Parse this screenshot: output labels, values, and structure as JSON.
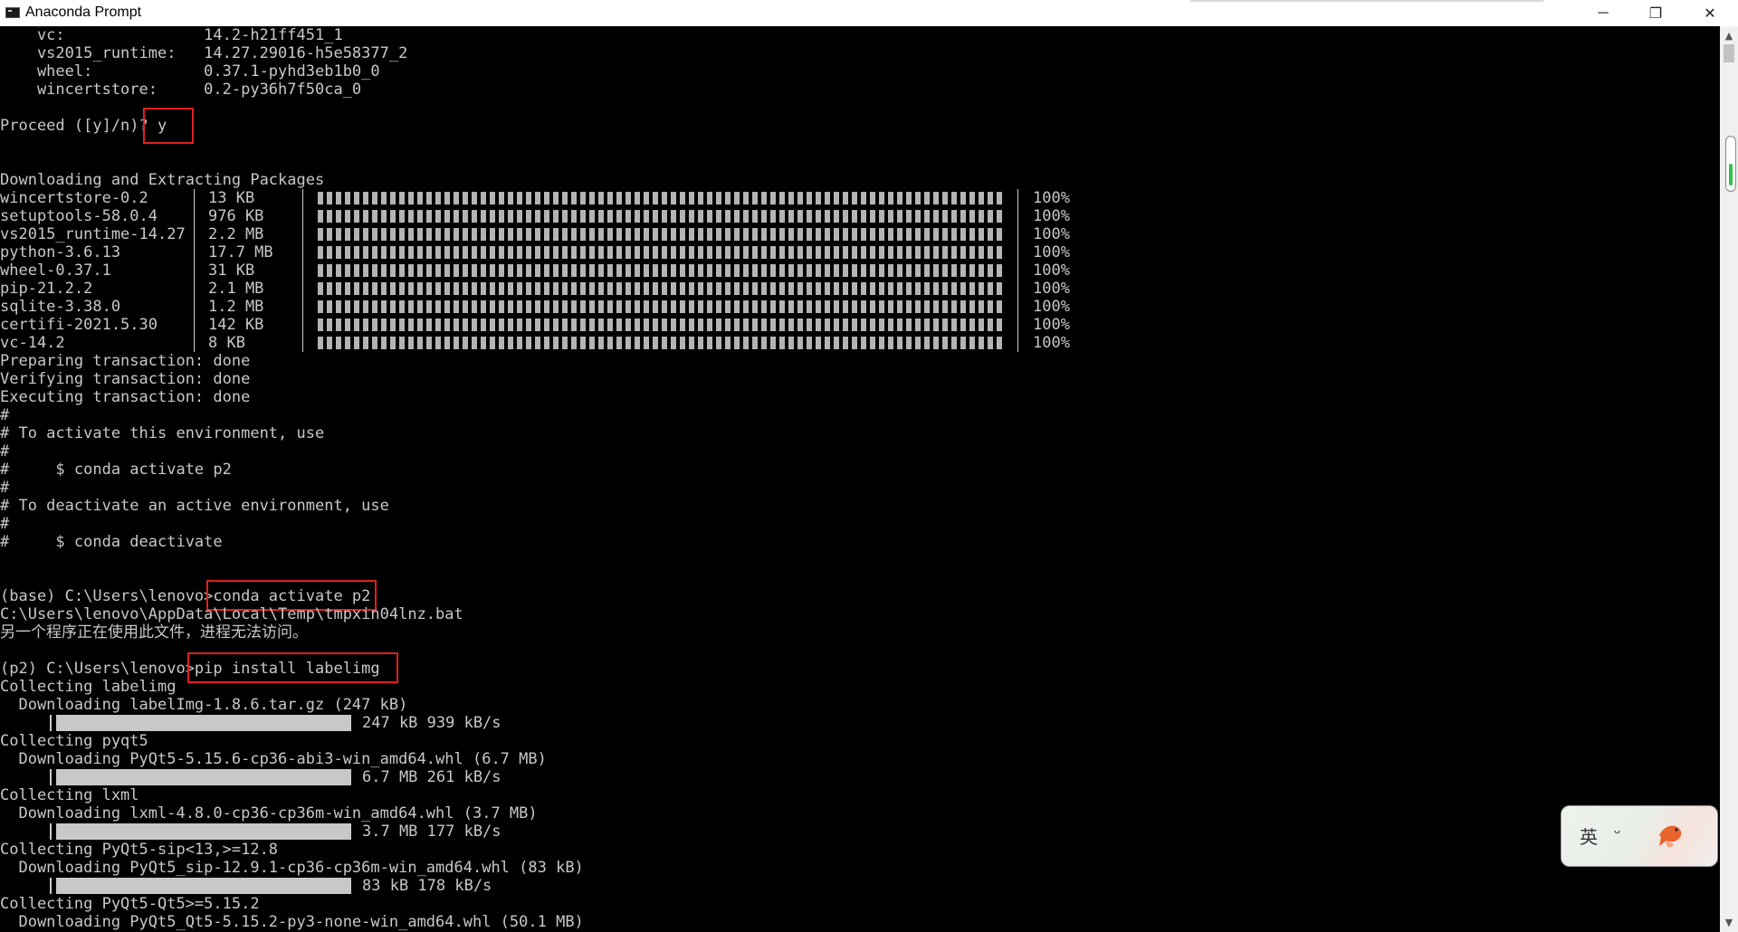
{
  "window": {
    "title": "Anaconda Prompt",
    "minimize": "─",
    "maximize": "❐",
    "close": "✕"
  },
  "pre_lines": [
    "    vc:               14.2-h21ff451_1",
    "    vs2015_runtime:   14.27.29016-h5e58377_2",
    "    wheel:            0.37.1-pyhd3eb1b0_0",
    "    wincertstore:     0.2-py36h7f50ca_0"
  ],
  "proceed": "Proceed ([y]/n)? y",
  "downloading_header": "Downloading and Extracting Packages",
  "packages": [
    {
      "name": "wincertstore-0.2",
      "size": "13 KB",
      "pct": "100%"
    },
    {
      "name": "setuptools-58.0.4",
      "size": "976 KB",
      "pct": "100%"
    },
    {
      "name": "vs2015_runtime-14.27",
      "size": "2.2 MB",
      "pct": "100%"
    },
    {
      "name": "python-3.6.13",
      "size": "17.7 MB",
      "pct": "100%"
    },
    {
      "name": "wheel-0.37.1",
      "size": "31 KB",
      "pct": "100%"
    },
    {
      "name": "pip-21.2.2",
      "size": "2.1 MB",
      "pct": "100%"
    },
    {
      "name": "sqlite-3.38.0",
      "size": "1.2 MB",
      "pct": "100%"
    },
    {
      "name": "certifi-2021.5.30",
      "size": "142 KB",
      "pct": "100%"
    },
    {
      "name": "vc-14.2",
      "size": "8 KB",
      "pct": "100%"
    }
  ],
  "transaction_lines": [
    "Preparing transaction: done",
    "Verifying transaction: done",
    "Executing transaction: done",
    "#",
    "# To activate this environment, use",
    "#",
    "#     $ conda activate p2",
    "#",
    "# To deactivate an active environment, use",
    "#",
    "#     $ conda deactivate"
  ],
  "cmd1": "(base) C:\\Users\\lenovo>conda activate p2",
  "tmp_path": "C:\\Users\\lenovo\\AppData\\Local\\Temp\\tmpxin04lnz.bat",
  "error_msg": "另一个程序正在使用此文件，进程无法访问。",
  "cmd2": "(p2) C:\\Users\\lenovo>pip install labelimg",
  "pip_lines": [
    "Collecting labelimg",
    "  Downloading labelImg-1.8.6.tar.gz (247 kB)",
    "Collecting pyqt5",
    "  Downloading PyQt5-5.15.6-cp36-abi3-win_amd64.whl (6.7 MB)",
    "Collecting lxml",
    "  Downloading lxml-4.8.0-cp36-cp36m-win_amd64.whl (3.7 MB)",
    "Collecting PyQt5-sip<13,>=12.8",
    "  Downloading PyQt5_sip-12.9.1-cp36-cp36m-win_amd64.whl (83 kB)",
    "Collecting PyQt5-Qt5>=5.15.2",
    "  Downloading PyQt5_Qt5-5.15.2-py3-none-win_amd64.whl (50.1 MB)"
  ],
  "pip_progress": [
    {
      "text": "247 kB 939 kB/s",
      "fraction": 1.0
    },
    {
      "text": "6.7 MB 261 kB/s",
      "fraction": 1.0
    },
    {
      "text": "3.7 MB 177 kB/s",
      "fraction": 1.0
    },
    {
      "text": "83 kB 178 kB/s",
      "fraction": 1.0
    }
  ],
  "scroll": {
    "up": "▲",
    "down": "▼"
  },
  "ime": {
    "lang": "英",
    "mode": "ᵕ"
  },
  "colors": {
    "text": "#c8c8c8",
    "background": "#000000",
    "highlight": "#e02020"
  }
}
